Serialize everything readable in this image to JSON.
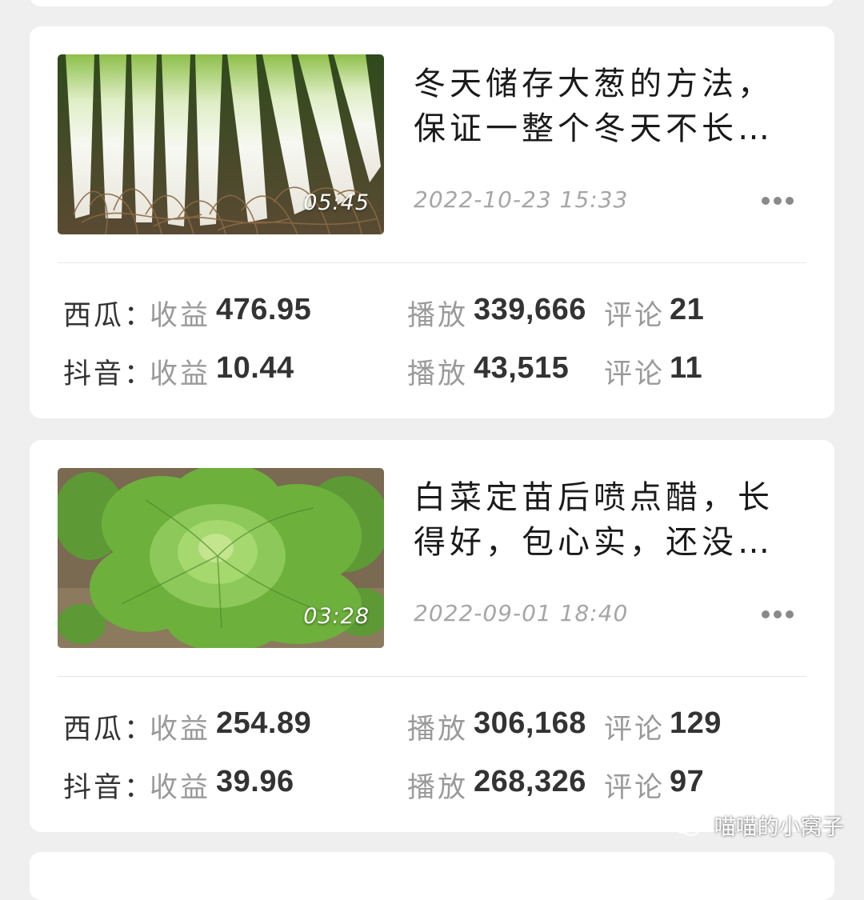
{
  "videos": [
    {
      "title": "冬天储存大葱的方法，保证一整个冬天不长…",
      "duration": "05:45",
      "date": "2022-10-23 15:33",
      "thumbnail_icon": "green-onion-image",
      "stats": [
        {
          "platform": "西瓜：",
          "income_label": "收益",
          "income": "476.95",
          "play_label": "播放",
          "plays": "339,666",
          "comment_label": "评论",
          "comments": "21"
        },
        {
          "platform": "抖音：",
          "income_label": "收益",
          "income": "10.44",
          "play_label": "播放",
          "plays": "43,515",
          "comment_label": "评论",
          "comments": "11"
        }
      ]
    },
    {
      "title": "白菜定苗后喷点醋，长得好，包心实，还没…",
      "duration": "03:28",
      "date": "2022-09-01 18:40",
      "thumbnail_icon": "cabbage-image",
      "stats": [
        {
          "platform": "西瓜：",
          "income_label": "收益",
          "income": "254.89",
          "play_label": "播放",
          "plays": "306,168",
          "comment_label": "评论",
          "comments": "129"
        },
        {
          "platform": "抖音：",
          "income_label": "收益",
          "income": "39.96",
          "play_label": "播放",
          "plays": "268,326",
          "comment_label": "评论",
          "comments": "97"
        }
      ]
    }
  ],
  "watermark": {
    "text": "喵喵的小窝子",
    "icon": "wechat-icon"
  },
  "colors": {
    "background": "#efefef",
    "card": "#ffffff",
    "label_gray": "#9a9a9a",
    "value_dark": "#333333"
  }
}
